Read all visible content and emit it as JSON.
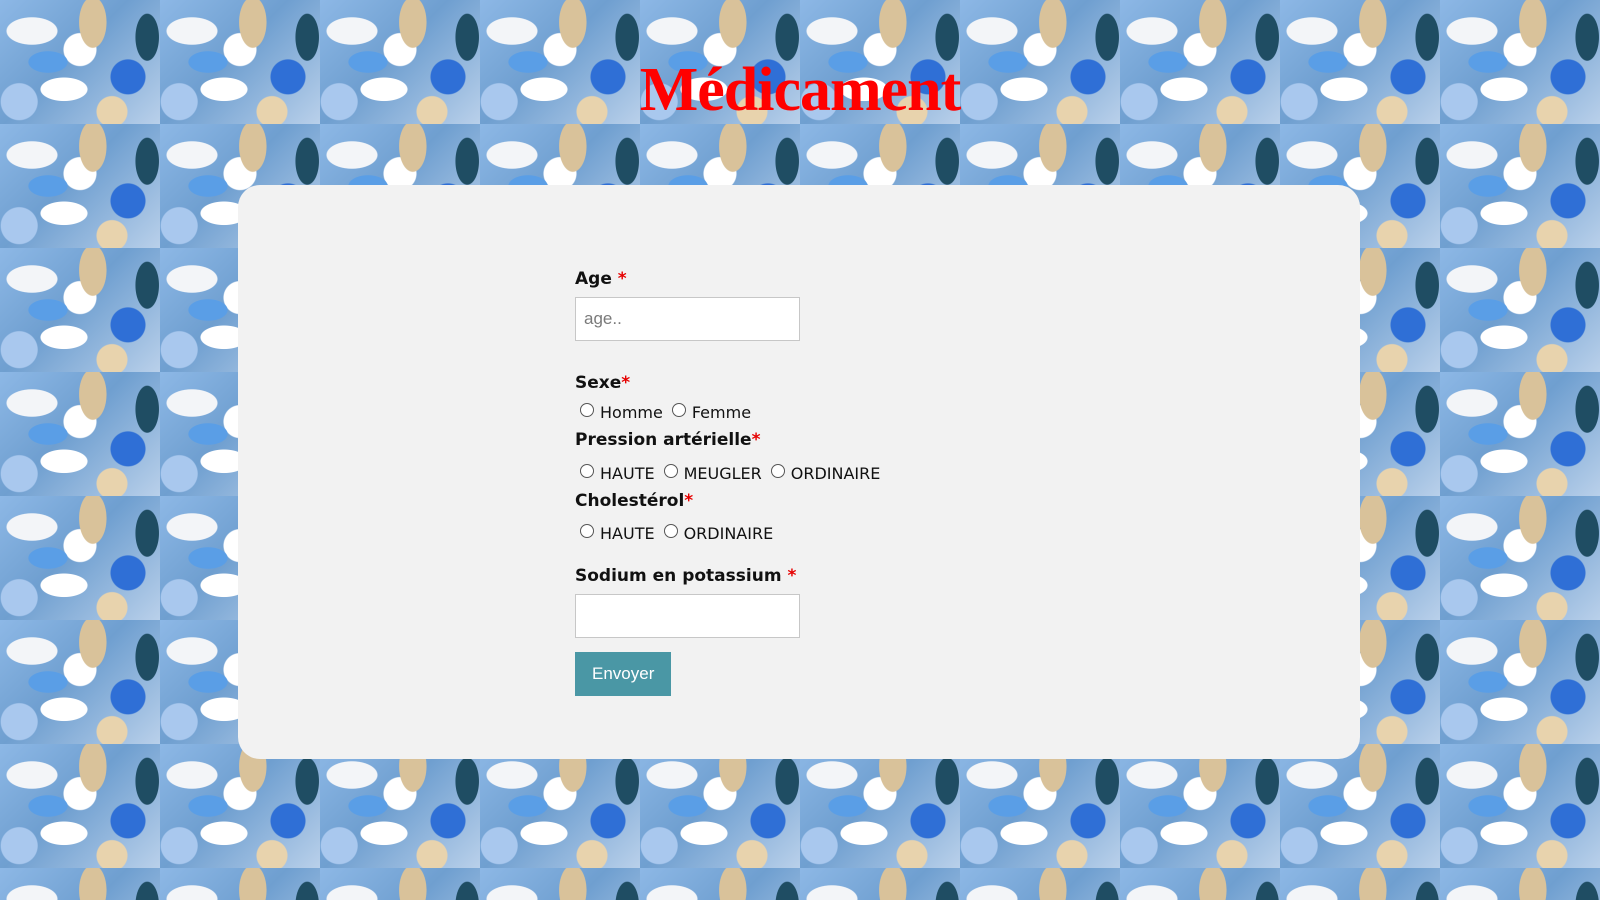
{
  "page": {
    "title": "Médicament"
  },
  "form": {
    "age": {
      "label": "Age",
      "required_marker": "*",
      "placeholder": "age..",
      "value": ""
    },
    "sexe": {
      "label": "Sexe",
      "required_marker": "*",
      "options": [
        "Homme",
        "Femme"
      ]
    },
    "pression": {
      "label": "Pression artérielle",
      "required_marker": "*",
      "options": [
        "HAUTE",
        "MEUGLER",
        "ORDINAIRE"
      ]
    },
    "cholesterol": {
      "label": "Cholestérol",
      "required_marker": "*",
      "options": [
        "HAUTE",
        "ORDINAIRE"
      ]
    },
    "sodium": {
      "label": "Sodium en potassium",
      "required_marker": "*",
      "value": ""
    },
    "submit_label": "Envoyer"
  },
  "colors": {
    "title": "#ff0000",
    "card_background": "#f2f2f2",
    "required": "#e60000",
    "button": "#4a97a5"
  }
}
